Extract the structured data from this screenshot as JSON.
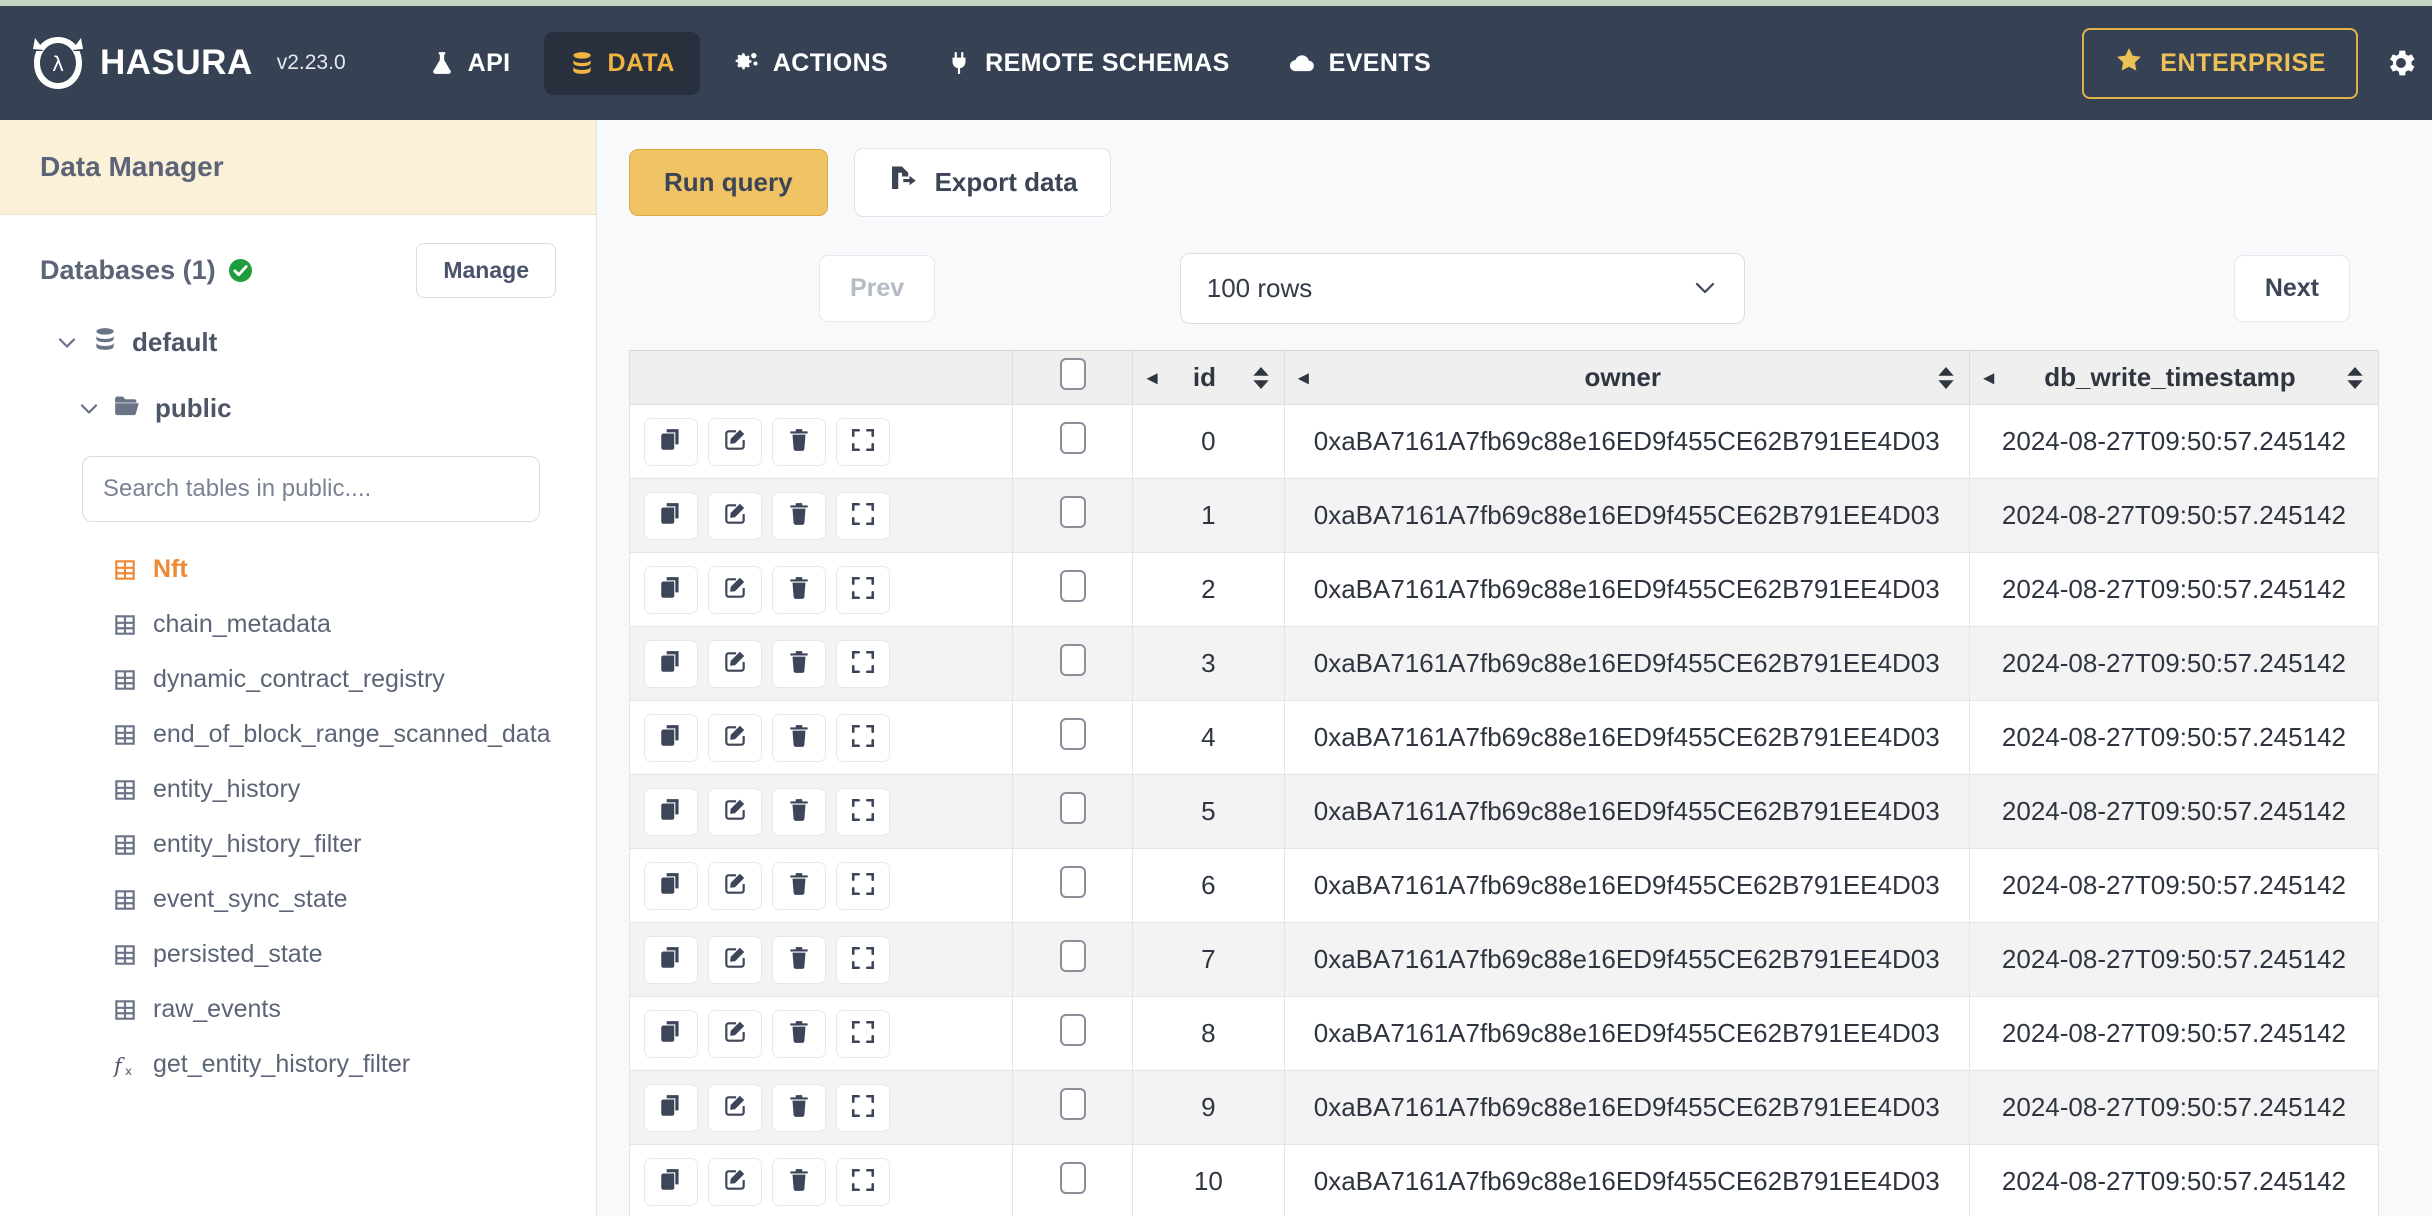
{
  "navbar": {
    "brand": "HASURA",
    "version": "v2.23.0",
    "items": [
      {
        "label": "API",
        "icon": "flask-icon",
        "active": false
      },
      {
        "label": "DATA",
        "icon": "database-icon",
        "active": true
      },
      {
        "label": "ACTIONS",
        "icon": "gears-icon",
        "active": false
      },
      {
        "label": "REMOTE SCHEMAS",
        "icon": "plug-icon",
        "active": false
      },
      {
        "label": "EVENTS",
        "icon": "cloud-icon",
        "active": false
      }
    ],
    "enterprise_label": "ENTERPRISE",
    "enterprise_icon": "star-icon",
    "settings_icon": "gear-icon",
    "accent_gold": "#edc156",
    "bar_color": "#364254",
    "top_strip_color": "#c3d5c3"
  },
  "sidebar": {
    "title": "Data Manager",
    "databases_label": "Databases (1)",
    "status_icon": "check-circle-icon",
    "manage_label": "Manage",
    "tree": {
      "database": "default",
      "database_icon": "database-icon",
      "schema": "public",
      "schema_icon": "folder-open-icon",
      "chevron_icon": "chevron-down-icon"
    },
    "search_placeholder": "Search tables in public....",
    "search_value": "",
    "selected_color": "#ed8936",
    "tables": [
      {
        "name": "Nft",
        "icon": "table-icon",
        "selected": true
      },
      {
        "name": "chain_metadata",
        "icon": "table-icon",
        "selected": false
      },
      {
        "name": "dynamic_contract_registry",
        "icon": "table-icon",
        "selected": false
      },
      {
        "name": "end_of_block_range_scanned_data",
        "icon": "table-icon",
        "selected": false
      },
      {
        "name": "entity_history",
        "icon": "table-icon",
        "selected": false
      },
      {
        "name": "entity_history_filter",
        "icon": "table-icon",
        "selected": false
      },
      {
        "name": "event_sync_state",
        "icon": "table-icon",
        "selected": false
      },
      {
        "name": "persisted_state",
        "icon": "table-icon",
        "selected": false
      },
      {
        "name": "raw_events",
        "icon": "table-icon",
        "selected": false
      },
      {
        "name": "get_entity_history_filter",
        "icon": "function-icon",
        "selected": false
      }
    ]
  },
  "toolbar": {
    "run_query_label": "Run query",
    "export_data_label": "Export data",
    "export_icon": "file-export-icon"
  },
  "pagination": {
    "prev_label": "Prev",
    "next_label": "Next",
    "rows_value": "100 rows",
    "chevron_icon": "chevron-down-icon",
    "prev_disabled": true
  },
  "table": {
    "columns": [
      {
        "key": "actions",
        "label": "",
        "sortable": false,
        "collapsible": false
      },
      {
        "key": "select",
        "label": "",
        "sortable": false,
        "collapsible": false
      },
      {
        "key": "id",
        "label": "id",
        "sortable": true,
        "collapsible": true
      },
      {
        "key": "owner",
        "label": "owner",
        "sortable": true,
        "collapsible": true
      },
      {
        "key": "db_write_timestamp",
        "label": "db_write_timestamp",
        "sortable": true,
        "collapsible": true
      }
    ],
    "row_actions": [
      {
        "name": "clone",
        "icon": "copy-icon"
      },
      {
        "name": "edit",
        "icon": "edit-icon"
      },
      {
        "name": "delete",
        "icon": "trash-icon"
      },
      {
        "name": "expand",
        "icon": "expand-icon"
      }
    ],
    "rows": [
      {
        "id": "0",
        "owner": "0xaBA7161A7fb69c88e16ED9f455CE62B791EE4D03",
        "db_write_timestamp": "2024-08-27T09:50:57.245142"
      },
      {
        "id": "1",
        "owner": "0xaBA7161A7fb69c88e16ED9f455CE62B791EE4D03",
        "db_write_timestamp": "2024-08-27T09:50:57.245142"
      },
      {
        "id": "2",
        "owner": "0xaBA7161A7fb69c88e16ED9f455CE62B791EE4D03",
        "db_write_timestamp": "2024-08-27T09:50:57.245142"
      },
      {
        "id": "3",
        "owner": "0xaBA7161A7fb69c88e16ED9f455CE62B791EE4D03",
        "db_write_timestamp": "2024-08-27T09:50:57.245142"
      },
      {
        "id": "4",
        "owner": "0xaBA7161A7fb69c88e16ED9f455CE62B791EE4D03",
        "db_write_timestamp": "2024-08-27T09:50:57.245142"
      },
      {
        "id": "5",
        "owner": "0xaBA7161A7fb69c88e16ED9f455CE62B791EE4D03",
        "db_write_timestamp": "2024-08-27T09:50:57.245142"
      },
      {
        "id": "6",
        "owner": "0xaBA7161A7fb69c88e16ED9f455CE62B791EE4D03",
        "db_write_timestamp": "2024-08-27T09:50:57.245142"
      },
      {
        "id": "7",
        "owner": "0xaBA7161A7fb69c88e16ED9f455CE62B791EE4D03",
        "db_write_timestamp": "2024-08-27T09:50:57.245142"
      },
      {
        "id": "8",
        "owner": "0xaBA7161A7fb69c88e16ED9f455CE62B791EE4D03",
        "db_write_timestamp": "2024-08-27T09:50:57.245142"
      },
      {
        "id": "9",
        "owner": "0xaBA7161A7fb69c88e16ED9f455CE62B791EE4D03",
        "db_write_timestamp": "2024-08-27T09:50:57.245142"
      },
      {
        "id": "10",
        "owner": "0xaBA7161A7fb69c88e16ED9f455CE62B791EE4D03",
        "db_write_timestamp": "2024-08-27T09:50:57.245142"
      }
    ]
  }
}
